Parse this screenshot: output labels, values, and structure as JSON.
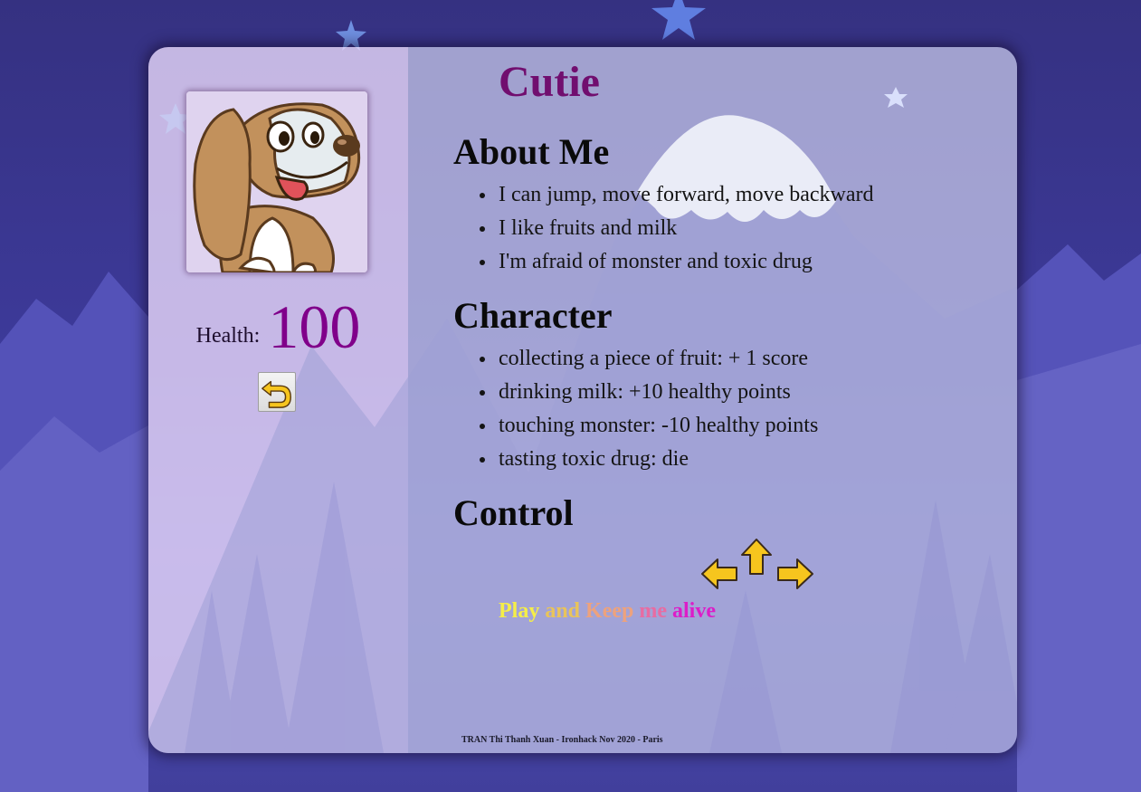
{
  "colors": {
    "page_background": "#3a369a",
    "name": "#710e6f",
    "health_value": "#80008a",
    "arrow_fill": "#f6c51e",
    "arrow_stroke": "#3a2a1a"
  },
  "profile": {
    "avatar_icon": "beagle-dog-icon",
    "health_label": "Health:",
    "health_value": 100,
    "back_icon": "undo-arrow-icon"
  },
  "main": {
    "name": "Cutie",
    "sections": {
      "about": {
        "title": "About Me",
        "items": [
          "I can jump, move forward, move backward",
          "I like fruits and milk",
          "I'm afraid of monster and toxic drug"
        ]
      },
      "character": {
        "title": "Character",
        "items": [
          "collecting a piece of fruit: + 1 score",
          "drinking milk: +10 healthy points",
          "touching monster: -10 healthy points",
          "tasting toxic drug: die"
        ]
      },
      "control": {
        "title": "Control",
        "icons": [
          "arrow-left-icon",
          "arrow-up-icon",
          "arrow-right-icon"
        ]
      }
    },
    "tagline": {
      "words": [
        "Play",
        "and",
        "Keep",
        "me",
        "alive"
      ]
    },
    "footer": "TRAN Thi Thanh Xuan - Ironhack Nov 2020 - Paris"
  }
}
